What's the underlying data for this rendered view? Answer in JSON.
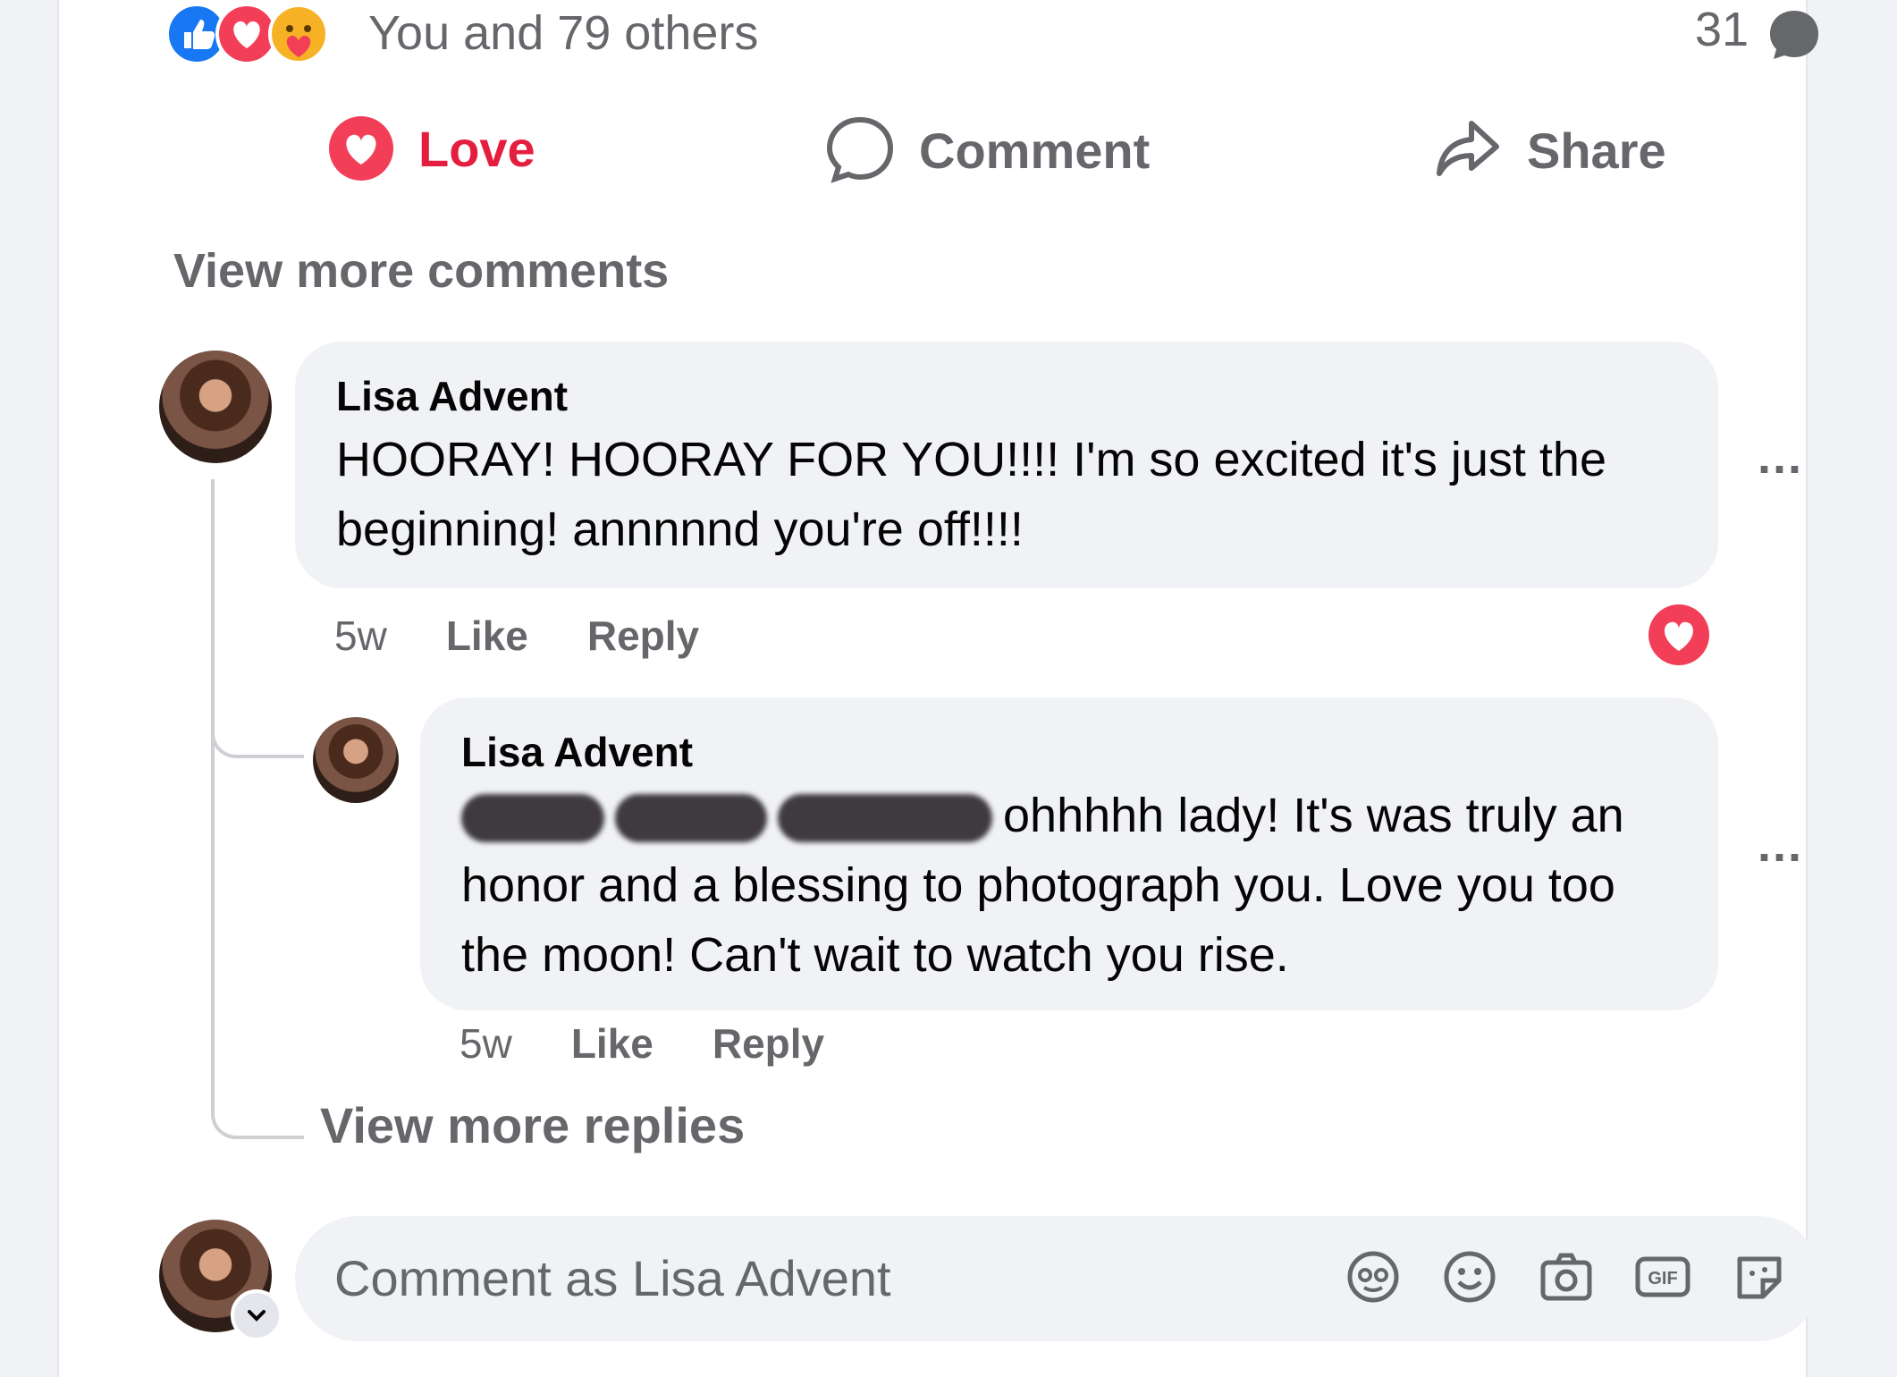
{
  "reactions": {
    "icons": [
      "like-icon",
      "love-icon",
      "care-icon"
    ],
    "summary": "You and 79 others",
    "comment_count": "31"
  },
  "actions": {
    "love_label": "Love",
    "comment_label": "Comment",
    "share_label": "Share"
  },
  "view_more_comments": "View more comments",
  "comments": [
    {
      "author": "Lisa Advent",
      "text": "HOORAY! HOORAY FOR YOU!!!! I'm so excited it's just the beginning! annnnnd you're off!!!!",
      "time": "5w",
      "like_label": "Like",
      "reply_label": "Reply",
      "reaction": "love-icon",
      "more": "..."
    }
  ],
  "replies": [
    {
      "author": "Lisa Advent",
      "text": "ohhhhh lady! It's was truly an honor and a blessing to photograph you. Love you too the moon! Can't wait to watch you rise.",
      "time": "5w",
      "like_label": "Like",
      "reply_label": "Reply",
      "more": "..."
    }
  ],
  "view_more_replies": "View more replies",
  "composer": {
    "placeholder": "Comment as Lisa Advent",
    "tools": [
      "avatar-sticker-icon",
      "emoji-icon",
      "camera-icon",
      "gif-icon",
      "sticker-icon"
    ]
  },
  "colors": {
    "love_red": "#e41e3f",
    "like_blue": "#1877f2",
    "secondary_text": "#65676b",
    "bubble_bg": "#f0f2f5"
  }
}
